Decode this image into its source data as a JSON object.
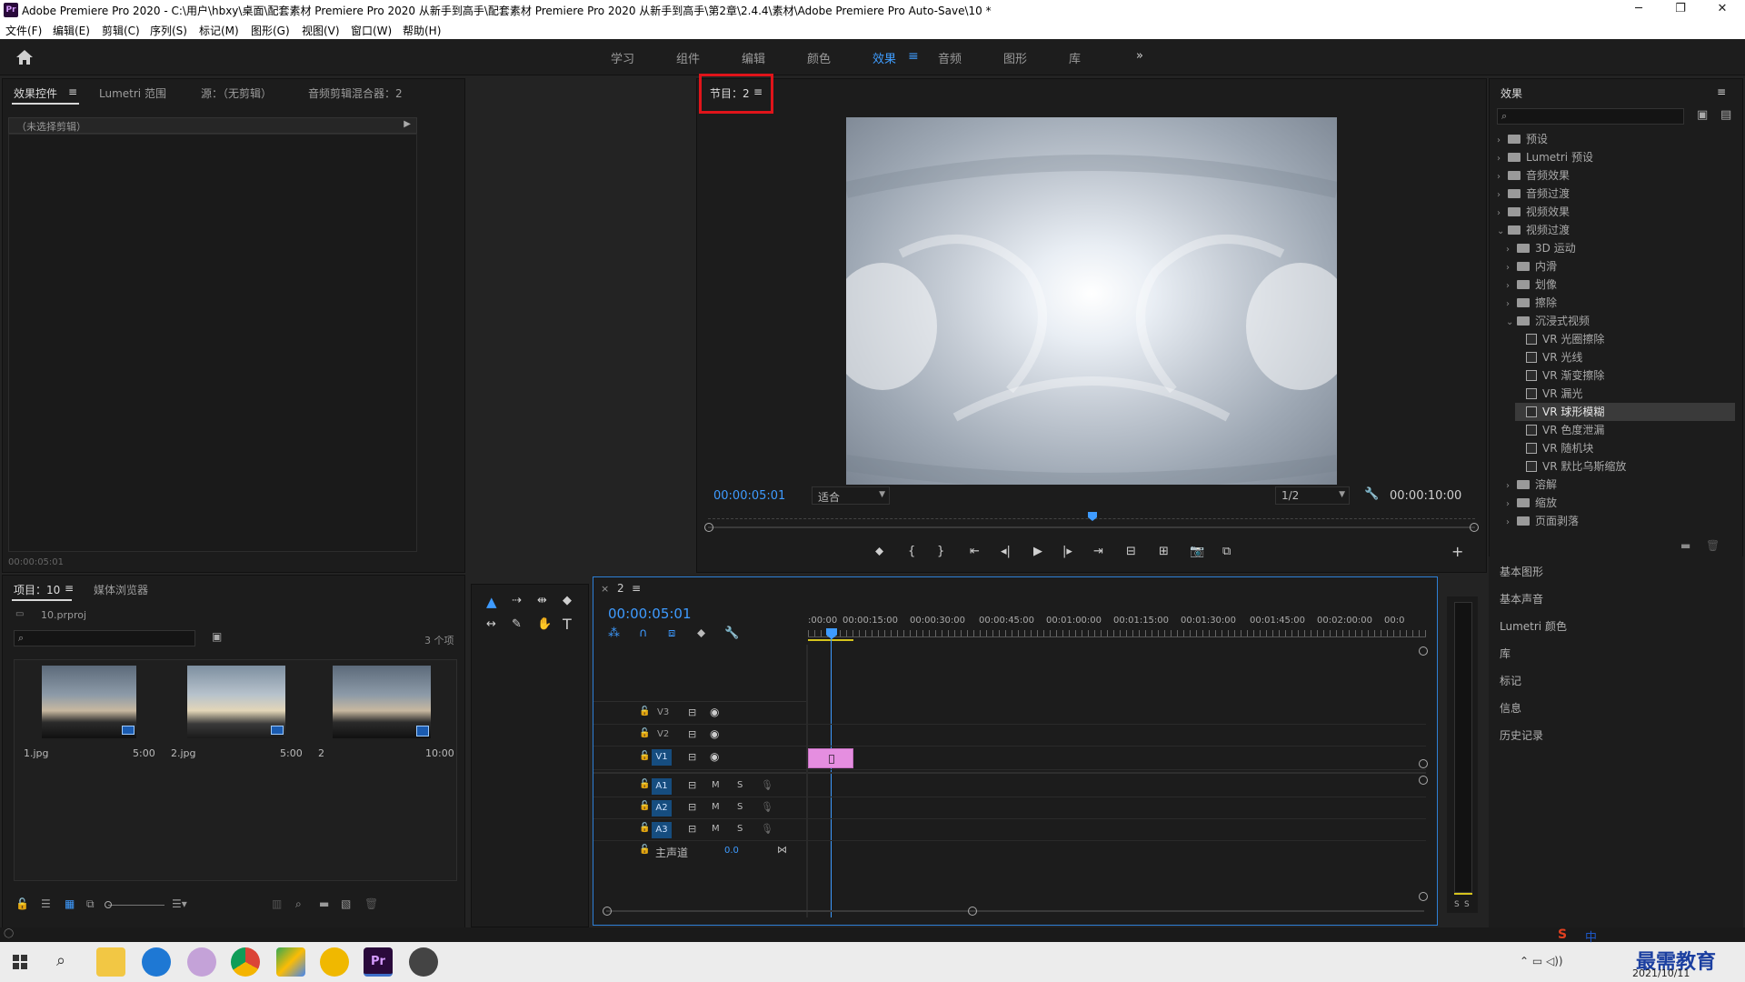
{
  "window": {
    "title": "Adobe Premiere Pro 2020 - C:\\用户\\hbxy\\桌面\\配套素材 Premiere Pro 2020 从新手到高手\\配套素材 Premiere Pro 2020 从新手到高手\\第2章\\2.4.4\\素材\\Adobe Premiere Pro Auto-Save\\10 *",
    "minimize": "─",
    "maximize": "❐",
    "close": "✕"
  },
  "menu": [
    "文件(F)",
    "编辑(E)",
    "剪辑(C)",
    "序列(S)",
    "标记(M)",
    "图形(G)",
    "视图(V)",
    "窗口(W)",
    "帮助(H)"
  ],
  "workspaces": {
    "items": [
      "学习",
      "组件",
      "编辑",
      "颜色",
      "效果",
      "音频",
      "图形",
      "库"
    ],
    "active": "效果",
    "more": "»"
  },
  "source_panel": {
    "tabs": [
      "效果控件",
      "Lumetri 范围",
      "源：（无剪辑）",
      "音频剪辑混合器：2"
    ],
    "no_clip": "（未选择剪辑）",
    "timecode": "00:00:05:01"
  },
  "program_monitor": {
    "tab": "节目：2",
    "timecode_current": "00:00:05:01",
    "fit": "适合",
    "resolution": "1/2",
    "timecode_total": "00:00:10:00",
    "highlight_color": "#e0141a"
  },
  "effects_panel": {
    "title": "效果",
    "tree": [
      {
        "label": "预设",
        "level": 0,
        "type": "folder",
        "open": false
      },
      {
        "label": "Lumetri 预设",
        "level": 0,
        "type": "folder",
        "open": false
      },
      {
        "label": "音频效果",
        "level": 0,
        "type": "folder",
        "open": false
      },
      {
        "label": "音频过渡",
        "level": 0,
        "type": "folder",
        "open": false
      },
      {
        "label": "视频效果",
        "level": 0,
        "type": "folder",
        "open": false
      },
      {
        "label": "视频过渡",
        "level": 0,
        "type": "folder",
        "open": true
      },
      {
        "label": "3D 运动",
        "level": 1,
        "type": "folder",
        "open": false
      },
      {
        "label": "内滑",
        "level": 1,
        "type": "folder",
        "open": false
      },
      {
        "label": "划像",
        "level": 1,
        "type": "folder",
        "open": false
      },
      {
        "label": "擦除",
        "level": 1,
        "type": "folder",
        "open": false
      },
      {
        "label": "沉浸式视频",
        "level": 1,
        "type": "folder",
        "open": true
      },
      {
        "label": "VR 光圈擦除",
        "level": 2,
        "type": "fx"
      },
      {
        "label": "VR 光线",
        "level": 2,
        "type": "fx"
      },
      {
        "label": "VR 渐变擦除",
        "level": 2,
        "type": "fx"
      },
      {
        "label": "VR 漏光",
        "level": 2,
        "type": "fx"
      },
      {
        "label": "VR 球形模糊",
        "level": 2,
        "type": "fx",
        "selected": true
      },
      {
        "label": "VR 色度泄漏",
        "level": 2,
        "type": "fx"
      },
      {
        "label": "VR 随机块",
        "level": 2,
        "type": "fx"
      },
      {
        "label": "VR 默比乌斯缩放",
        "level": 2,
        "type": "fx"
      },
      {
        "label": "溶解",
        "level": 1,
        "type": "folder",
        "open": false
      },
      {
        "label": "缩放",
        "level": 1,
        "type": "folder",
        "open": false
      },
      {
        "label": "页面剥落",
        "level": 1,
        "type": "folder",
        "open": false
      }
    ],
    "collapsed_panels": [
      "基本图形",
      "基本声音",
      "Lumetri 颜色",
      "库",
      "标记",
      "信息",
      "历史记录"
    ]
  },
  "project_panel": {
    "tabs": [
      "项目：10",
      "媒体浏览器"
    ],
    "file": "10.prproj",
    "count": "3 个项",
    "items": [
      {
        "name": "1.jpg",
        "duration": "5:00"
      },
      {
        "name": "2.jpg",
        "duration": "5:00"
      },
      {
        "name": "2",
        "duration": "10:00"
      }
    ]
  },
  "timeline": {
    "tab": "2",
    "timecode": "00:00:05:01",
    "ruler": [
      ":00:00",
      "00:00:15:00",
      "00:00:30:00",
      "00:00:45:00",
      "00:01:00:00",
      "00:01:15:00",
      "00:01:30:00",
      "00:01:45:00",
      "00:02:00:00",
      "00:0"
    ],
    "video_tracks": [
      "V3",
      "V2",
      "V1"
    ],
    "audio_tracks": [
      "A1",
      "A2",
      "A3"
    ],
    "master": "主声道",
    "master_value": "0.0",
    "clip_color": "#e58ee0",
    "m": "M",
    "s": "S"
  },
  "taskbar": {
    "time": "2021/10/11",
    "watermark": "最需教育",
    "ime": "中"
  }
}
